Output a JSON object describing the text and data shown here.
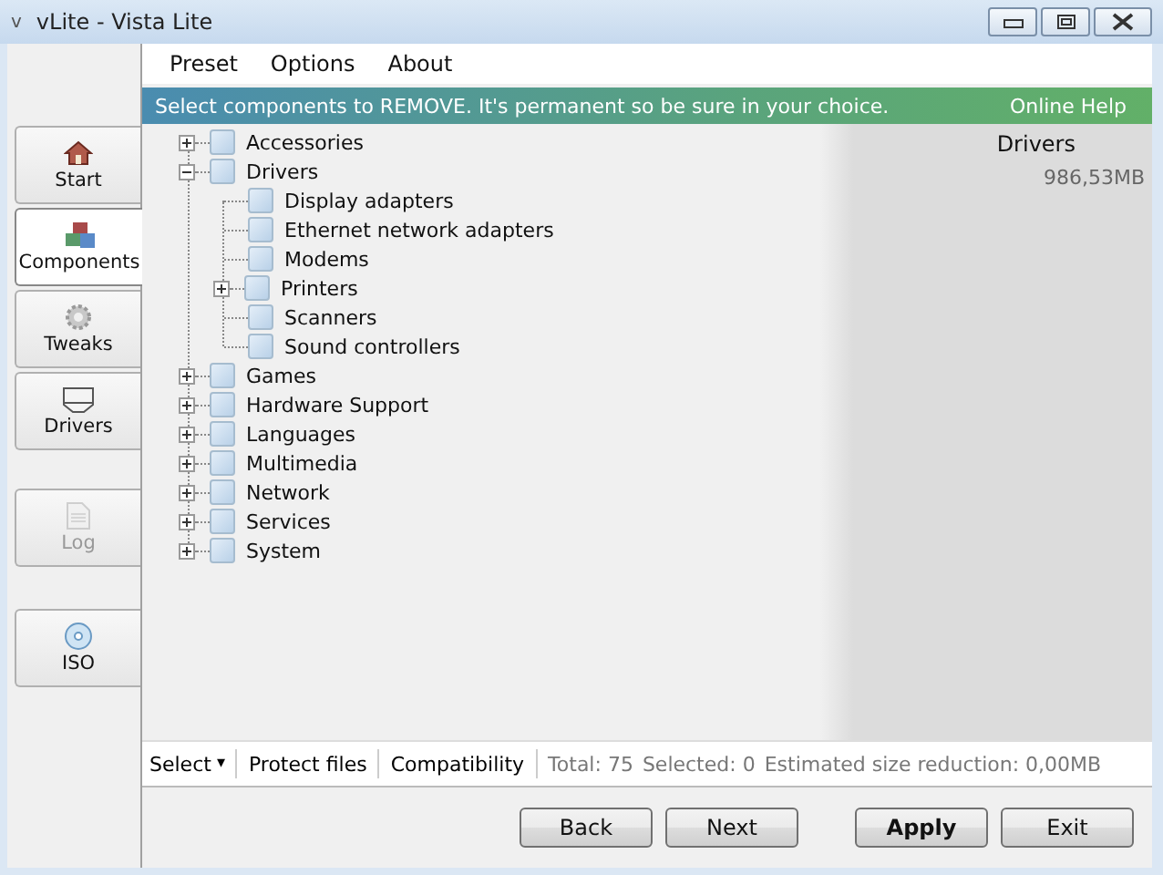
{
  "window": {
    "logo": "v",
    "title": "vLite - Vista Lite"
  },
  "sidebar": {
    "items": [
      {
        "label": "Start",
        "selected": false,
        "disabled": false
      },
      {
        "label": "Components",
        "selected": true,
        "disabled": false
      },
      {
        "label": "Tweaks",
        "selected": false,
        "disabled": false
      },
      {
        "label": "Drivers",
        "selected": false,
        "disabled": false
      },
      {
        "label": "Log",
        "selected": false,
        "disabled": true
      },
      {
        "label": "ISO",
        "selected": false,
        "disabled": false
      }
    ]
  },
  "menu": [
    "Preset",
    "Options",
    "About"
  ],
  "banner": {
    "text": "Select components to REMOVE. It's permanent so be sure in your choice.",
    "link": "Online Help"
  },
  "tree": [
    {
      "label": "Accessories",
      "kind": "folder",
      "expanded": false,
      "checked": false
    },
    {
      "label": "Drivers",
      "kind": "folder",
      "expanded": true,
      "checked": false,
      "children": [
        {
          "label": "Display adapters",
          "kind": "leaf",
          "checked": false
        },
        {
          "label": "Ethernet network adapters",
          "kind": "leaf",
          "checked": false
        },
        {
          "label": "Modems",
          "kind": "leaf",
          "checked": false
        },
        {
          "label": "Printers",
          "kind": "folder",
          "expanded": false,
          "checked": false
        },
        {
          "label": "Scanners",
          "kind": "leaf",
          "checked": false
        },
        {
          "label": "Sound controllers",
          "kind": "leaf",
          "checked": false
        }
      ]
    },
    {
      "label": "Games",
      "kind": "folder",
      "expanded": false,
      "checked": false
    },
    {
      "label": "Hardware Support",
      "kind": "folder",
      "expanded": false,
      "checked": false
    },
    {
      "label": "Languages",
      "kind": "folder",
      "expanded": false,
      "checked": false
    },
    {
      "label": "Multimedia",
      "kind": "folder",
      "expanded": false,
      "checked": false
    },
    {
      "label": "Network",
      "kind": "folder",
      "expanded": false,
      "checked": false
    },
    {
      "label": "Services",
      "kind": "folder",
      "expanded": false,
      "checked": false
    },
    {
      "label": "System",
      "kind": "folder",
      "expanded": false,
      "checked": false
    }
  ],
  "details": {
    "title": "Drivers",
    "size": "986,53MB"
  },
  "toolbar": {
    "select": "Select",
    "caret": "▾",
    "protect": "Protect files",
    "compat": "Compatibility",
    "total": "Total: 75",
    "selected": "Selected: 0",
    "reduction": "Estimated size reduction: 0,00MB"
  },
  "buttons": [
    {
      "label": "Back",
      "default": false
    },
    {
      "label": "Next",
      "default": false
    },
    {
      "label": "Apply",
      "default": true
    },
    {
      "label": "Exit",
      "default": false
    }
  ]
}
